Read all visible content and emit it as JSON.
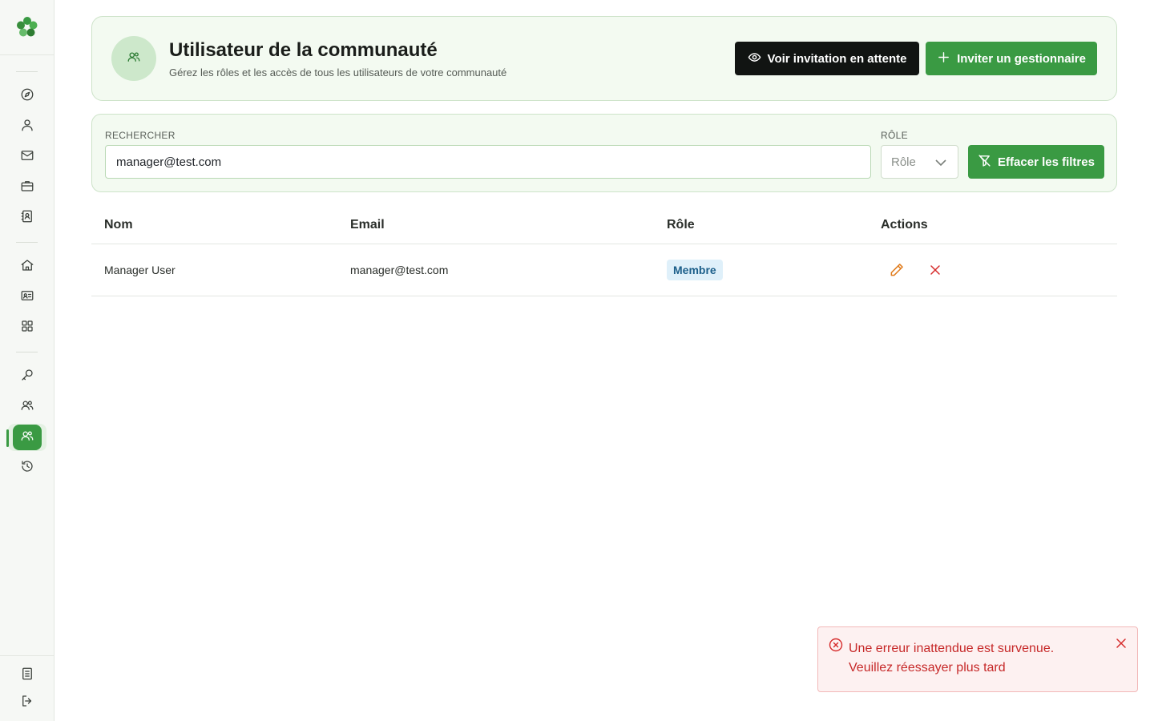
{
  "header": {
    "title": "Utilisateur de la communauté",
    "subtitle": "Gérez les rôles et les accès de tous les utilisateurs de votre communauté",
    "view_pending_label": "Voir invitation en attente",
    "invite_manager_label": "Inviter un gestionnaire"
  },
  "filters": {
    "search_label": "RECHERCHER",
    "search_value": "manager@test.com",
    "role_label": "RÔLE",
    "role_placeholder": "Rôle",
    "clear_label": "Effacer les filtres"
  },
  "table": {
    "columns": [
      "Nom",
      "Email",
      "Rôle",
      "Actions"
    ],
    "rows": [
      {
        "name": "Manager User",
        "email": "manager@test.com",
        "role": "Membre"
      }
    ]
  },
  "toast": {
    "message": "Une erreur inattendue est survenue. Veuillez réessayer plus tard"
  },
  "sidebar": {
    "items": [
      {
        "icon": "compass-icon"
      },
      {
        "icon": "user-icon"
      },
      {
        "icon": "mail-icon"
      },
      {
        "icon": "briefcase-icon"
      },
      {
        "icon": "contact-book-icon"
      },
      {
        "icon": "home-icon"
      },
      {
        "icon": "id-card-icon"
      },
      {
        "icon": "grid-icon"
      },
      {
        "icon": "key-icon"
      },
      {
        "icon": "users-icon"
      },
      {
        "icon": "community-users-icon",
        "active": true
      },
      {
        "icon": "history-icon"
      },
      {
        "icon": "document-icon"
      },
      {
        "icon": "logout-icon"
      }
    ]
  },
  "colors": {
    "brand_green": "#3a9a43",
    "dark_button": "#111412",
    "error_red": "#c62828",
    "badge_blue": "#1c5f8a"
  }
}
